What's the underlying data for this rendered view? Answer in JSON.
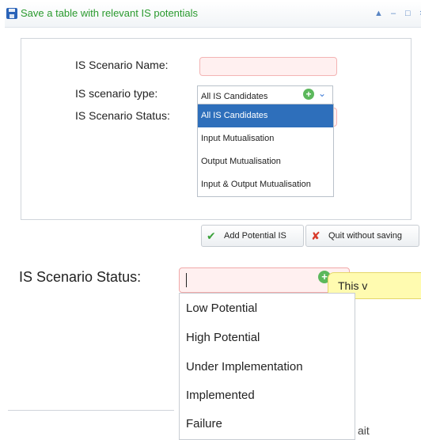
{
  "dialog": {
    "title": "Save a table with relevant IS potentials",
    "window_controls": [
      "▲",
      "–",
      "□",
      "×"
    ]
  },
  "form": {
    "labels": {
      "name": "IS Scenario Name:",
      "type": "IS scenario type:",
      "status": "IS Scenario Status:"
    },
    "type_select": {
      "selected": "All IS Candidates",
      "options": [
        "All IS Candidates",
        "Input Mutualisation",
        "Output Mutualisation",
        "Input & Output Mutualisation"
      ]
    },
    "buttons": {
      "add": "Add Potential IS",
      "quit": "Quit without saving"
    }
  },
  "zoom": {
    "status_label": "IS Scenario Status:",
    "tooltip": "This v",
    "status_options": [
      "Low Potential",
      "High Potential",
      "Under Implementation",
      "Implemented",
      "Failure"
    ],
    "bottom_fragment": "ait"
  },
  "colors": {
    "title_green": "#2a9a2e",
    "selected_option_bg": "#2e6fbb",
    "required_field_bg": "#fff0f0",
    "tooltip_bg": "#fffbb0"
  }
}
